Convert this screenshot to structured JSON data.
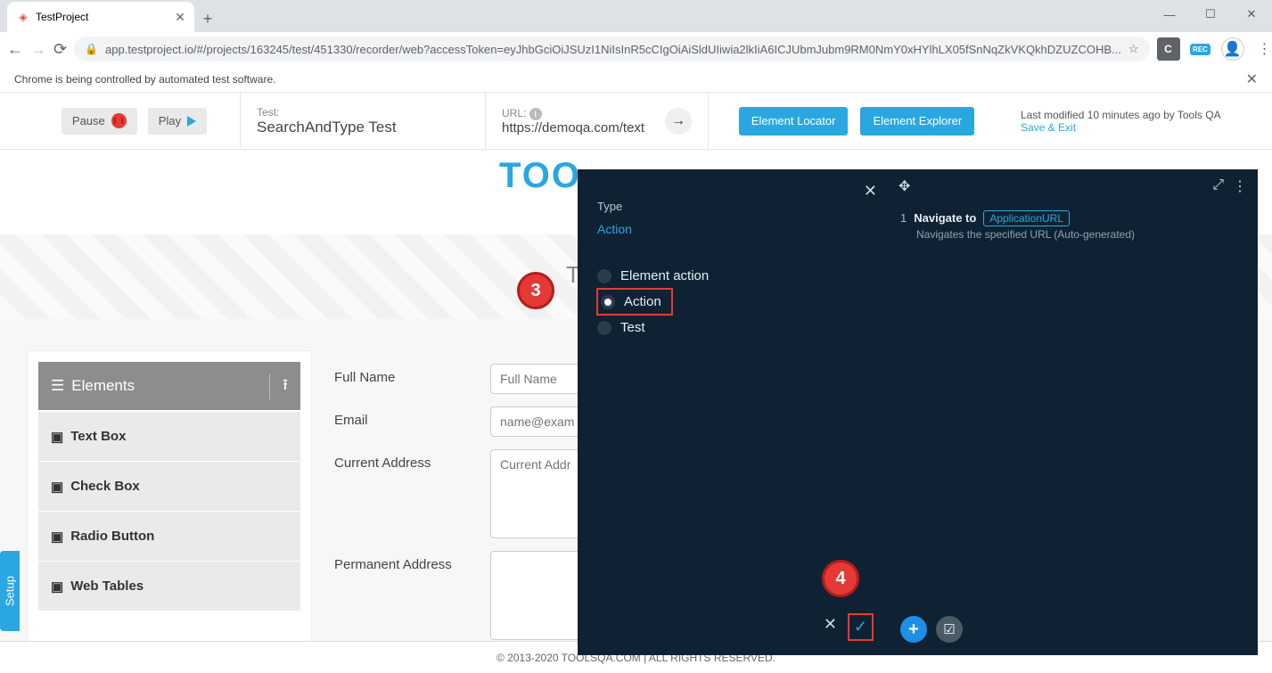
{
  "browser": {
    "tab_title": "TestProject",
    "url": "app.testproject.io/#/projects/163245/test/451330/recorder/web?accessToken=eyJhbGciOiJSUzI1NiIsInR5cCIgOiAiSldUIiwia2lkIiA6ICJUbmJubm9RM0NmY0xHYlhLX05fSnNqZkVKQkhDZUZCOHB...",
    "automation_notice": "Chrome is being controlled by automated test software.",
    "new_tab": "+",
    "rec_badge": "REC"
  },
  "window": {
    "min": "—",
    "max": "☐",
    "close": "✕"
  },
  "recorder": {
    "pause": "Pause",
    "play": "Play",
    "test_lbl": "Test:",
    "test_name": "SearchAndType Test",
    "url_lbl": "URL:",
    "url_val": "https://demoqa.com/text",
    "go_arrow": "→",
    "element_locator": "Element Locator",
    "element_explorer": "Element Explorer",
    "modified_text": "Last modified 10 minutes ago by Tools QA",
    "save_exit": "Save & Exit"
  },
  "page": {
    "logo_text": "TOO",
    "heading": "T",
    "sidebar": {
      "header": "Elements",
      "items": [
        "Text Box",
        "Check Box",
        "Radio Button",
        "Web Tables"
      ]
    },
    "form": {
      "full_name_lbl": "Full Name",
      "full_name_ph": "Full Name",
      "email_lbl": "Email",
      "email_ph": "name@exam",
      "curr_addr_lbl": "Current Address",
      "curr_addr_ph": "Current Addr",
      "perm_addr_lbl": "Permanent Address"
    },
    "footer": "© 2013-2020 TOOLSQA.COM | ALL RIGHTS RESERVED."
  },
  "type_panel": {
    "close": "✕",
    "label": "Type",
    "link": "Action",
    "opt_element_action": "Element action",
    "opt_action": "Action",
    "opt_test": "Test",
    "footer_cancel": "✕",
    "footer_confirm": "✓"
  },
  "steps": {
    "move": "✥",
    "collapse": "⤢",
    "menu": "⋮",
    "first": {
      "num": "1",
      "title": "Navigate to",
      "chip": "ApplicationURL",
      "desc": "Navigates the specified URL (Auto-generated)"
    },
    "add": "+",
    "select": "☑"
  },
  "setup_tab": "Setup",
  "callouts": {
    "c3": "3",
    "c4": "4"
  }
}
